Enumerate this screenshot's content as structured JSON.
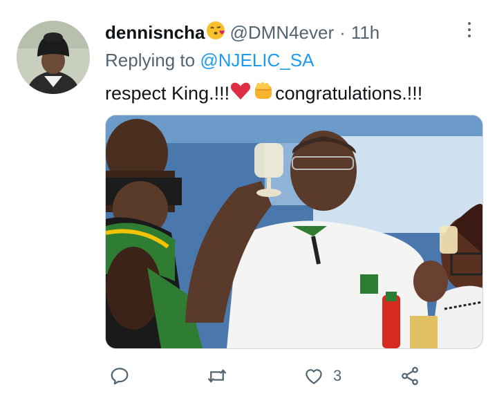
{
  "tweet": {
    "display_name": "dennisncha",
    "name_emoji": "face-blowing-kiss-emoji",
    "handle": "@DMN4ever",
    "separator": "·",
    "time": "11h",
    "replying_prefix": "Replying to",
    "replying_to": "@NJELIC_SA",
    "text_part1": "respect King.!!!",
    "text_emoji1": "red-heart-emoji",
    "text_emoji2": "oncoming-fist-emoji",
    "text_part2": "congratulations.!!!",
    "media_alt": "photo",
    "icons": {
      "more": "more-dots-icon",
      "reply": "reply-icon",
      "retweet": "retweet-icon",
      "like": "heart-icon",
      "share": "share-icon"
    }
  },
  "actions": {
    "reply_count": "",
    "retweet_count": "",
    "like_count": "3",
    "share_count": ""
  },
  "colors": {
    "link": "#1d9bf0",
    "secondary_text": "#536471",
    "primary_text": "#0f1419"
  }
}
